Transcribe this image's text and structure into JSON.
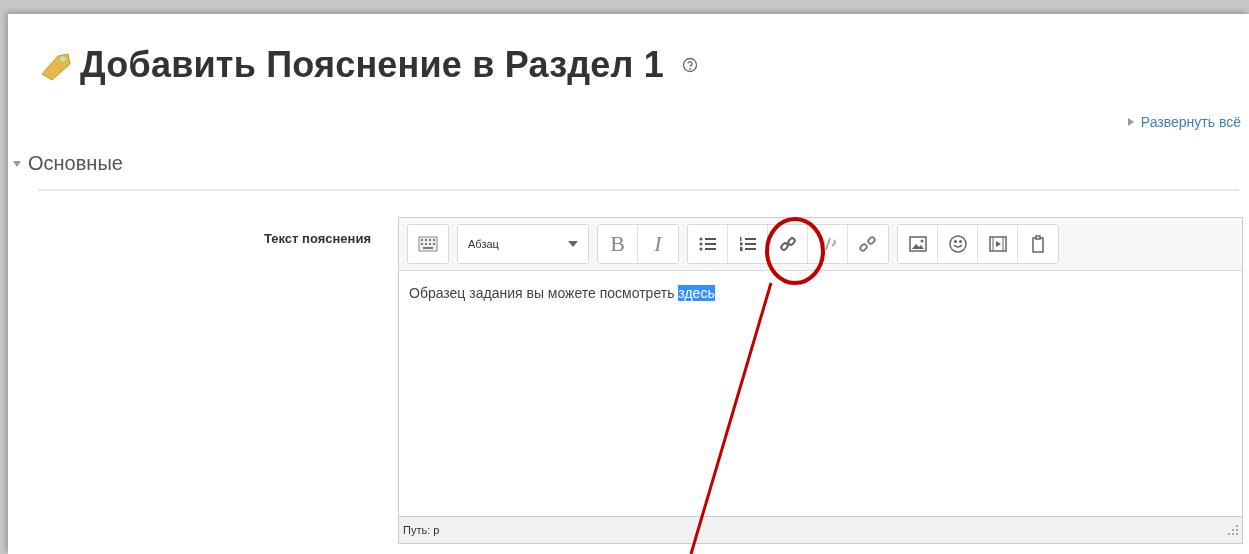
{
  "page": {
    "title": "Добавить Пояснение в Раздел 1",
    "expand_all": "Развернуть всё"
  },
  "section": {
    "title": "Основные",
    "expanded": true
  },
  "field": {
    "label": "Текст пояснения"
  },
  "editor": {
    "toolbar": [
      [
        {
          "kind": "icon"
        }
      ],
      [
        {
          "kind": "dropdown",
          "label": "Абзац"
        }
      ],
      [
        {
          "kind": "text",
          "label": "B"
        },
        {
          "kind": "text",
          "label": "I"
        }
      ],
      [
        {
          "kind": "icon"
        },
        {
          "kind": "icon"
        },
        {
          "kind": "icon"
        },
        {
          "kind": "icon"
        },
        {
          "kind": "icon"
        }
      ],
      [
        {
          "kind": "icon"
        },
        {
          "kind": "icon"
        },
        {
          "kind": "icon"
        },
        {
          "kind": "icon"
        }
      ]
    ],
    "content": [
      {
        "text": "Образец задания вы можете посмотреть ",
        "selected": false
      },
      {
        "text": "здесь",
        "selected": true
      }
    ],
    "path": "Путь: p"
  }
}
